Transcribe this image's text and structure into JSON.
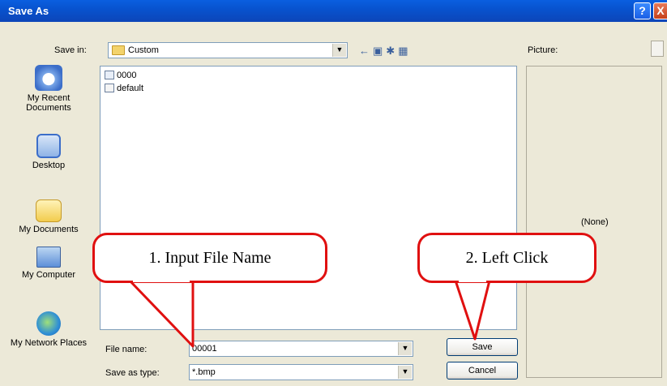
{
  "window": {
    "title": "Save As",
    "help_glyph": "?",
    "close_glyph": "X"
  },
  "toolbar": {
    "save_in_label": "Save in:",
    "save_in_value": "Custom"
  },
  "places": [
    {
      "label": "My Recent Documents"
    },
    {
      "label": "Desktop"
    },
    {
      "label": "My Documents"
    },
    {
      "label": "My Computer"
    },
    {
      "label": "My Network Places"
    }
  ],
  "files": [
    {
      "name": "0000"
    },
    {
      "name": "default"
    }
  ],
  "preview": {
    "label": "Picture:",
    "value": "(None)"
  },
  "form": {
    "file_name_label": "File name:",
    "file_name_value": "00001",
    "save_type_label": "Save as type:",
    "save_type_value": "*.bmp",
    "save_button": "Save",
    "cancel_button": "Cancel"
  },
  "annotations": {
    "step1": "1. Input File Name",
    "step2": "2. Left Click"
  },
  "colors": {
    "titlebar": "#0853cf",
    "callout_border": "#e01010",
    "dialog_bg": "#ece9d8"
  }
}
